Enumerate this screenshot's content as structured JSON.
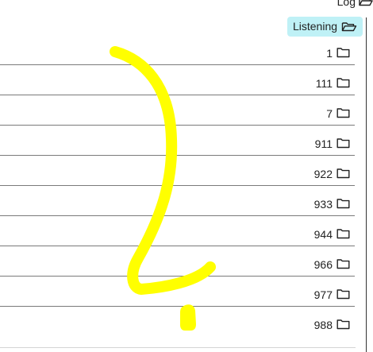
{
  "header": {
    "log_label": "Log",
    "log_icon": "folder-open-icon"
  },
  "badge": {
    "label": "Listening",
    "icon": "folder-open-icon",
    "background": "#bff1f6"
  },
  "items": [
    {
      "label": "1",
      "icon": "folder-icon"
    },
    {
      "label": "111",
      "icon": "folder-icon"
    },
    {
      "label": "7",
      "icon": "folder-icon"
    },
    {
      "label": "911",
      "icon": "folder-icon"
    },
    {
      "label": "922",
      "icon": "folder-icon"
    },
    {
      "label": "933",
      "icon": "folder-icon"
    },
    {
      "label": "944",
      "icon": "folder-icon"
    },
    {
      "label": "966",
      "icon": "folder-icon"
    },
    {
      "label": "977",
      "icon": "folder-icon"
    },
    {
      "label": "988",
      "icon": "folder-icon"
    }
  ],
  "annotation": {
    "color": "#ffff00"
  }
}
